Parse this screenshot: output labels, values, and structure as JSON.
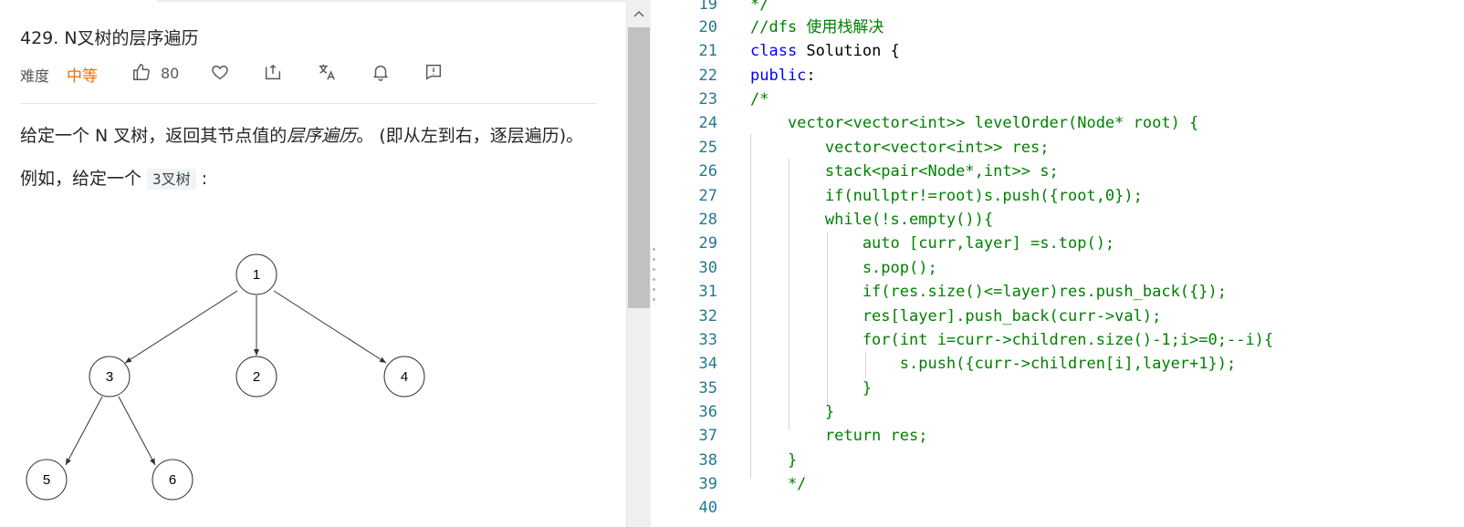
{
  "problem": {
    "title": "429. N叉树的层序遍历",
    "difficulty_label": "难度",
    "difficulty_value": "中等",
    "like_count": "80",
    "description_before": "给定一个 N 叉树，返回其节点值的",
    "description_emph": "层序遍历",
    "description_after": "。 (即从左到右，逐层遍历)。",
    "example_before": "例如，给定一个 ",
    "example_code": "3叉树",
    "example_after": " :",
    "tree_nodes": [
      "1",
      "3",
      "2",
      "4",
      "5",
      "6"
    ]
  },
  "icons": [
    "thumbs-up-icon",
    "heart-icon",
    "share-icon",
    "translate-icon",
    "bell-icon",
    "feedback-icon",
    "chevron-up-icon"
  ],
  "colors": {
    "difficulty": "#ef6c00",
    "line_number": "#237893",
    "comment": "#008000",
    "keyword": "#0000ff"
  },
  "editor": {
    "lines": [
      {
        "num": "19",
        "text": "*/"
      },
      {
        "num": "20",
        "text": "//dfs 使用栈解决"
      },
      {
        "num": "21",
        "kw": "class",
        "rest": " Solution {"
      },
      {
        "num": "22",
        "kw": "public",
        "rest": ":"
      },
      {
        "num": "23",
        "text": "/*"
      },
      {
        "num": "24",
        "text": "    vector<vector<int>> levelOrder(Node* root) {"
      },
      {
        "num": "25",
        "text": "        vector<vector<int>> res;"
      },
      {
        "num": "26",
        "text": "        stack<pair<Node*,int>> s;"
      },
      {
        "num": "27",
        "text": "        if(nullptr!=root)s.push({root,0});"
      },
      {
        "num": "28",
        "text": "        while(!s.empty()){"
      },
      {
        "num": "29",
        "text": "            auto [curr,layer] =s.top();"
      },
      {
        "num": "30",
        "text": "            s.pop();"
      },
      {
        "num": "31",
        "text": "            if(res.size()<=layer)res.push_back({});"
      },
      {
        "num": "32",
        "text": "            res[layer].push_back(curr->val);"
      },
      {
        "num": "33",
        "text": "            for(int i=curr->children.size()-1;i>=0;--i){"
      },
      {
        "num": "34",
        "text": "                s.push({curr->children[i],layer+1});"
      },
      {
        "num": "35",
        "text": "            }"
      },
      {
        "num": "36",
        "text": "        }"
      },
      {
        "num": "37",
        "text": "        return res;"
      },
      {
        "num": "38",
        "text": "    }"
      },
      {
        "num": "39",
        "text": "    */"
      },
      {
        "num": "40",
        "text": ""
      }
    ]
  }
}
